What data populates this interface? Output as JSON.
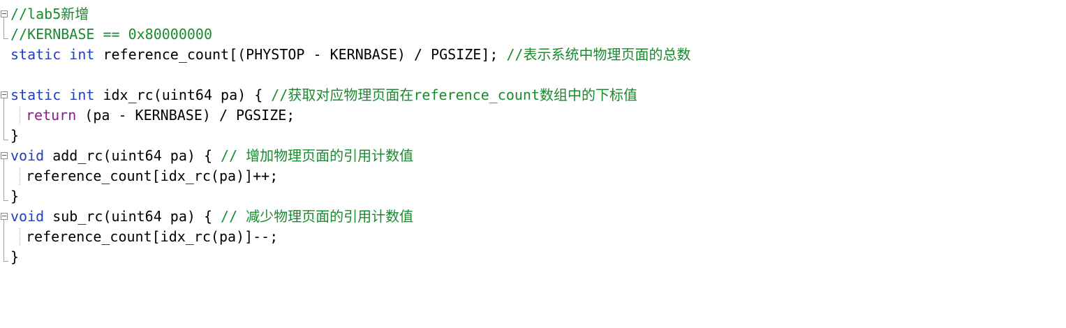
{
  "editor": {
    "lines": [
      {
        "comment": "//lab5新增"
      },
      {
        "comment": "//KERNBASE == 0x80000000"
      },
      {
        "kw1": "static",
        "kw2": "int",
        "code": "reference_count[(PHYSTOP - KERNBASE) / PGSIZE];",
        "comment": "//表示系统中物理页面的总数"
      },
      {},
      {
        "kw1": "static",
        "kw2": "int",
        "code": "idx_rc(uint64 pa) {",
        "comment": "//获取对应物理页面在reference_count数组中的下标值"
      },
      {
        "kw": "return",
        "code": "(pa - KERNBASE) / PGSIZE;"
      },
      {
        "code": "}"
      },
      {
        "kw": "void",
        "code": "add_rc(uint64 pa) {",
        "comment": "// 增加物理页面的引用计数值"
      },
      {
        "code": "reference_count[idx_rc(pa)]++;"
      },
      {
        "code": "}"
      },
      {
        "kw": "void",
        "code": "sub_rc(uint64 pa) {",
        "comment": "// 减少物理页面的引用计数值"
      },
      {
        "code": "reference_count[idx_rc(pa)]--;"
      },
      {
        "code": "}"
      }
    ]
  },
  "colors": {
    "keyword": "#1f3fbf",
    "return_keyword": "#8b1a8b",
    "comment": "#1a8a2e",
    "text": "#000000"
  },
  "icons": {
    "fold": "fold-minus-icon"
  }
}
